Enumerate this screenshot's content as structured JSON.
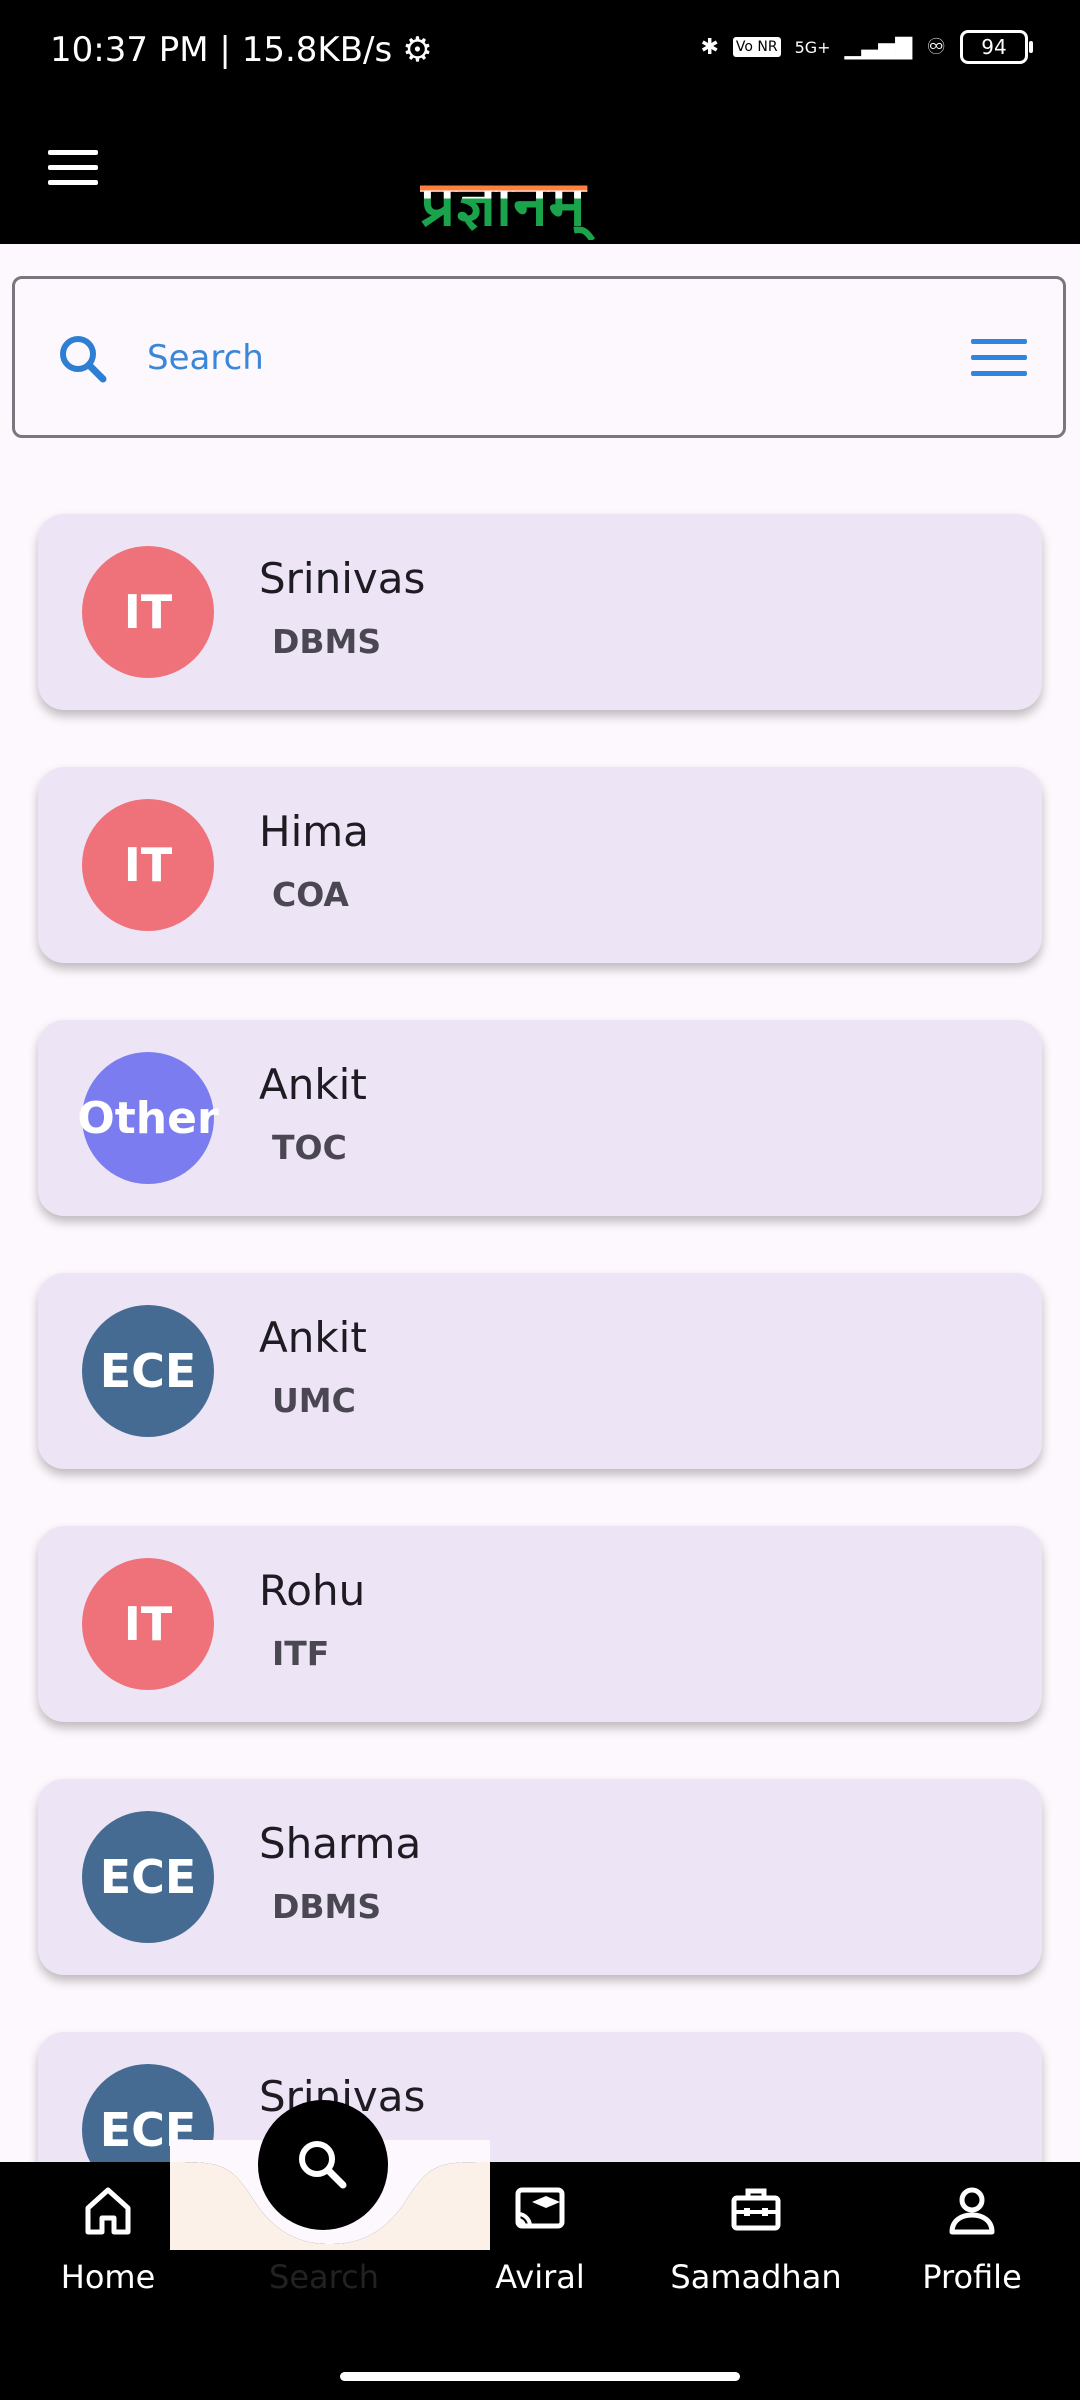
{
  "status_bar": {
    "time": "10:37 PM | 15.8KB/s",
    "network_label": "5G+",
    "volte": "Vo NR",
    "battery": "94"
  },
  "app": {
    "logo_text": "प्रज्ञानम्"
  },
  "search": {
    "placeholder": "Search"
  },
  "items": [
    {
      "avatar": "IT",
      "color": "#ef727a",
      "name": "Srinivas",
      "subject": "DBMS"
    },
    {
      "avatar": "IT",
      "color": "#ef727a",
      "name": "Hima",
      "subject": "COA"
    },
    {
      "avatar": "Other",
      "color": "#7b7cf0",
      "name": "Ankit",
      "subject": "TOC"
    },
    {
      "avatar": "ECE",
      "color": "#456b93",
      "name": "Ankit",
      "subject": "UMC"
    },
    {
      "avatar": "IT",
      "color": "#ef727a",
      "name": "Rohu",
      "subject": "ITF"
    },
    {
      "avatar": "ECE",
      "color": "#456b93",
      "name": "Sharma",
      "subject": "DBMS"
    },
    {
      "avatar": "ECE",
      "color": "#456b93",
      "name": "Srinivas",
      "subject": ""
    }
  ],
  "nav": {
    "home": "Home",
    "search": "Search",
    "aviral": "Aviral",
    "samadhan": "Samadhan",
    "profile": "Profile"
  }
}
